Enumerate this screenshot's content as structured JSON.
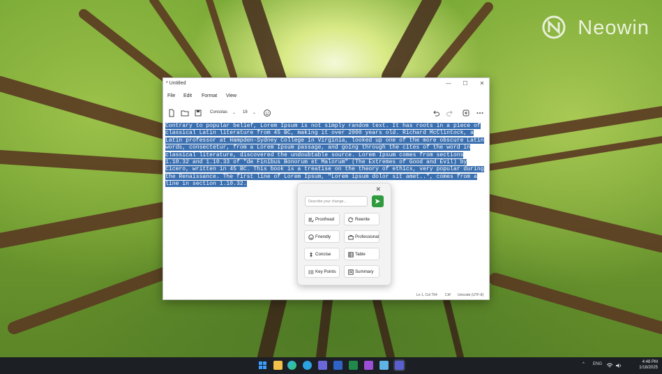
{
  "watermark": "Neowin",
  "window": {
    "title": "* Untitled",
    "controls": {
      "minimize": "—",
      "maximize": "☐",
      "close": "✕"
    }
  },
  "menu": {
    "file": "File",
    "edit": "Edit",
    "format": "Format",
    "view": "View"
  },
  "toolbar": {
    "font": "Consolas",
    "size": "18"
  },
  "editor": {
    "lines": [
      "Contrary to popular belief, Lorem Ipsum is not simply random text. It has roots in a piece of",
      "classical Latin literature from 45 BC, making it over 2000 years old. Richard McClintock, a",
      "Latin professor at Hampden-Sydney College in Virginia, looked up one of the more obscure Latin",
      "words, consectetur, from a Lorem Ipsum passage, and going through the cites of the word in",
      "classical literature, discovered the undoubtable source. Lorem Ipsum comes from sections",
      "1.10.32 and 1.10.33 of \"de Finibus Bonorum et Malorum\" (The Extremes of Good and Evil) by",
      "Cicero, written in 45 BC. This book is a treatise on the theory of ethics, very popular during",
      "the Renaissance. The first line of Lorem Ipsum, \"Lorem ipsum dolor sit amet..\", comes from a",
      "line in section 1.10.32."
    ]
  },
  "rewrite_popup": {
    "placeholder": "Describe your change...",
    "close": "✕",
    "buttons": {
      "proofread": "Proofread",
      "rewrite": "Rewrite",
      "friendly": "Friendly",
      "professional": "Professional",
      "concise": "Concise",
      "table": "Table",
      "key_points": "Key Points",
      "summary": "Summary"
    },
    "accent": "#2f9b3e"
  },
  "statusbar": {
    "position": "Ln 1, Col 764",
    "line_ending": "Crlf",
    "encoding": "Unicode (UTF-8)"
  },
  "taskbar": {
    "tray": {
      "chevron": "^",
      "lang": "ENG"
    },
    "clock": {
      "time": "4:48 PM",
      "date": "1/18/2025"
    }
  }
}
